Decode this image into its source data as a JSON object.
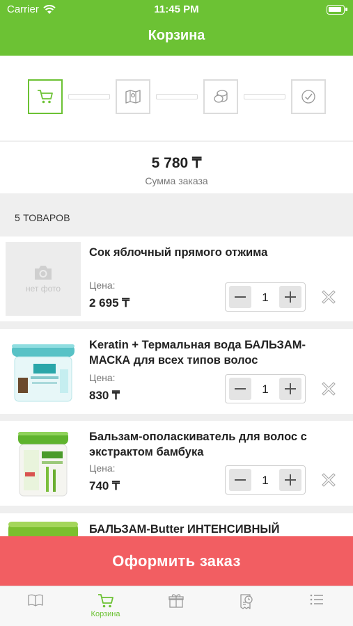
{
  "status_bar": {
    "carrier": "Carrier",
    "time": "11:45 PM"
  },
  "header": {
    "title": "Корзина"
  },
  "stepper": {
    "steps": [
      {
        "icon": "cart-icon",
        "active": true
      },
      {
        "icon": "map-icon",
        "active": false
      },
      {
        "icon": "coins-icon",
        "active": false
      },
      {
        "icon": "check-icon",
        "active": false
      }
    ]
  },
  "summary": {
    "total": "5 780 ₸",
    "label": "Сумма заказа"
  },
  "cart": {
    "count_label": "5 ТОВАРОВ",
    "price_label": "Цена:",
    "no_photo_label": "нет фото",
    "items": [
      {
        "name": "Сок яблочный прямого отжима",
        "price": "2 695 ₸",
        "qty": "1",
        "image": "no-photo"
      },
      {
        "name": "Keratin + Термальная вода БАЛЬЗАМ-МАСКА для всех типов волос",
        "price": "830 ₸",
        "qty": "1",
        "image": "teal-jar"
      },
      {
        "name": "Бальзам-ополаскиватель для волос с экстрактом бамбука",
        "price": "740 ₸",
        "qty": "1",
        "image": "green-jar"
      },
      {
        "name": "БАЛЬЗАМ-Butter ИНТЕНСИВНЫЙ",
        "image": "green-jar"
      }
    ]
  },
  "checkout": {
    "label": "Оформить заказ"
  },
  "tabbar": {
    "tabs": [
      {
        "icon": "book-icon",
        "label": ""
      },
      {
        "icon": "cart-icon",
        "label": "Корзина",
        "active": true
      },
      {
        "icon": "gift-icon",
        "label": ""
      },
      {
        "icon": "receipt-clock-icon",
        "label": ""
      },
      {
        "icon": "list-icon",
        "label": ""
      }
    ]
  },
  "colors": {
    "accent": "#6cc234",
    "checkout": "#f25e62",
    "background": "#efefef"
  }
}
